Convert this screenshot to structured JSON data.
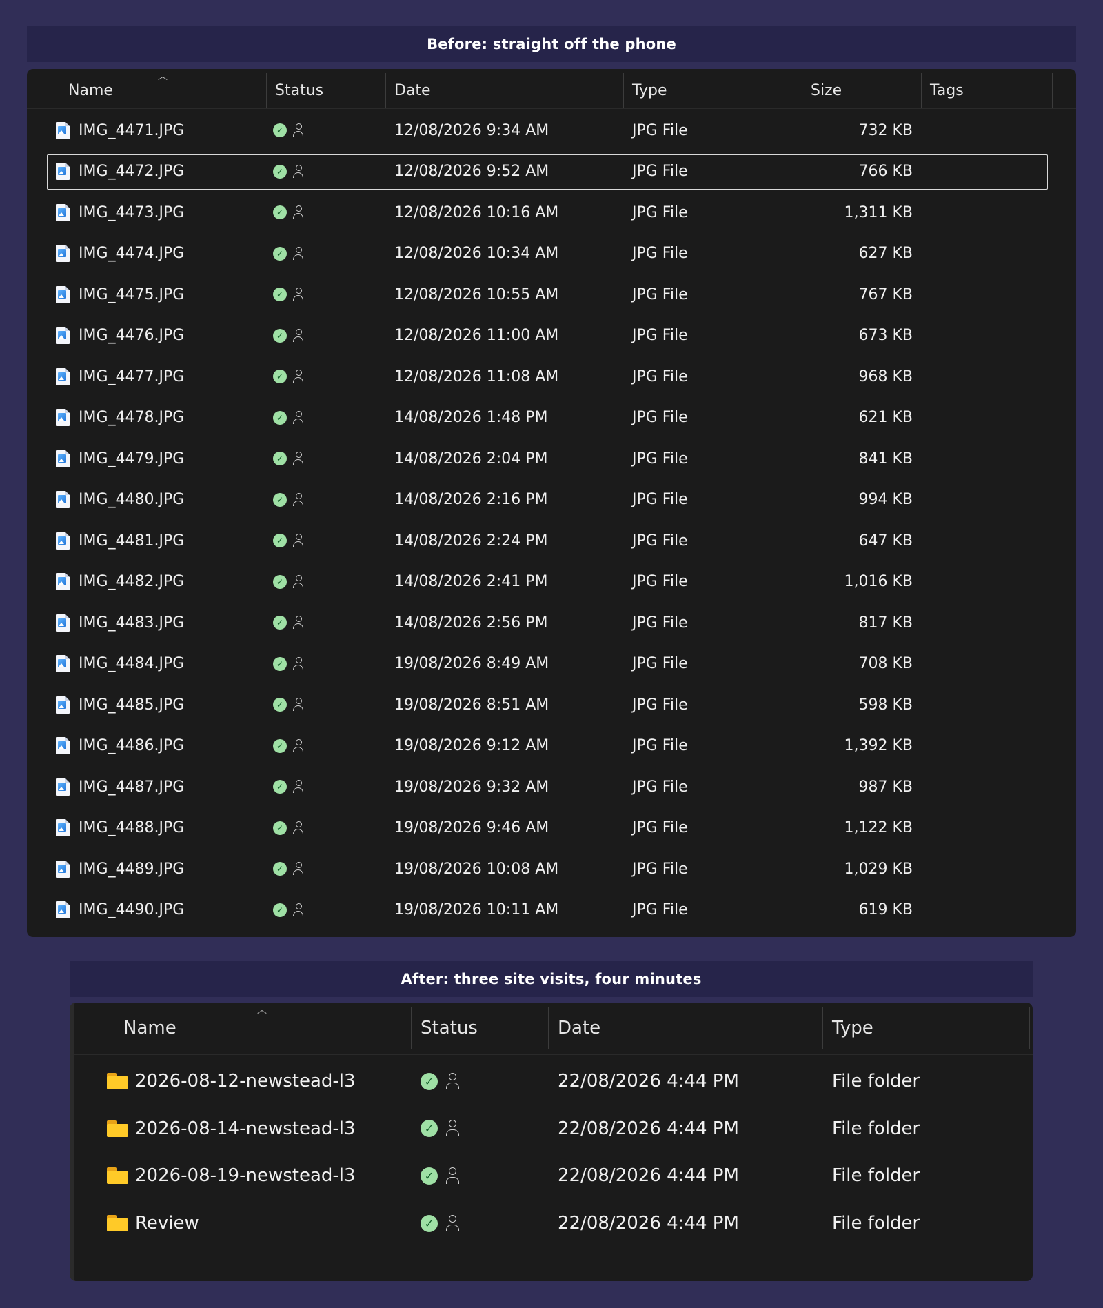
{
  "before": {
    "banner": "Before: straight off the phone",
    "columns": {
      "name": "Name",
      "status": "Status",
      "date": "Date",
      "type": "Type",
      "size": "Size",
      "tags": "Tags"
    },
    "selected_index": 1,
    "rows": [
      {
        "name": "IMG_4471.JPG",
        "date": "12/08/2026 9:34 AM",
        "type": "JPG File",
        "size": "732 KB"
      },
      {
        "name": "IMG_4472.JPG",
        "date": "12/08/2026 9:52 AM",
        "type": "JPG File",
        "size": "766 KB"
      },
      {
        "name": "IMG_4473.JPG",
        "date": "12/08/2026 10:16 AM",
        "type": "JPG File",
        "size": "1,311 KB"
      },
      {
        "name": "IMG_4474.JPG",
        "date": "12/08/2026 10:34 AM",
        "type": "JPG File",
        "size": "627 KB"
      },
      {
        "name": "IMG_4475.JPG",
        "date": "12/08/2026 10:55 AM",
        "type": "JPG File",
        "size": "767 KB"
      },
      {
        "name": "IMG_4476.JPG",
        "date": "12/08/2026 11:00 AM",
        "type": "JPG File",
        "size": "673 KB"
      },
      {
        "name": "IMG_4477.JPG",
        "date": "12/08/2026 11:08 AM",
        "type": "JPG File",
        "size": "968 KB"
      },
      {
        "name": "IMG_4478.JPG",
        "date": "14/08/2026 1:48 PM",
        "type": "JPG File",
        "size": "621 KB"
      },
      {
        "name": "IMG_4479.JPG",
        "date": "14/08/2026 2:04 PM",
        "type": "JPG File",
        "size": "841 KB"
      },
      {
        "name": "IMG_4480.JPG",
        "date": "14/08/2026 2:16 PM",
        "type": "JPG File",
        "size": "994 KB"
      },
      {
        "name": "IMG_4481.JPG",
        "date": "14/08/2026 2:24 PM",
        "type": "JPG File",
        "size": "647 KB"
      },
      {
        "name": "IMG_4482.JPG",
        "date": "14/08/2026 2:41 PM",
        "type": "JPG File",
        "size": "1,016 KB"
      },
      {
        "name": "IMG_4483.JPG",
        "date": "14/08/2026 2:56 PM",
        "type": "JPG File",
        "size": "817 KB"
      },
      {
        "name": "IMG_4484.JPG",
        "date": "19/08/2026 8:49 AM",
        "type": "JPG File",
        "size": "708 KB"
      },
      {
        "name": "IMG_4485.JPG",
        "date": "19/08/2026 8:51 AM",
        "type": "JPG File",
        "size": "598 KB"
      },
      {
        "name": "IMG_4486.JPG",
        "date": "19/08/2026 9:12 AM",
        "type": "JPG File",
        "size": "1,392 KB"
      },
      {
        "name": "IMG_4487.JPG",
        "date": "19/08/2026 9:32 AM",
        "type": "JPG File",
        "size": "987 KB"
      },
      {
        "name": "IMG_4488.JPG",
        "date": "19/08/2026 9:46 AM",
        "type": "JPG File",
        "size": "1,122 KB"
      },
      {
        "name": "IMG_4489.JPG",
        "date": "19/08/2026 10:08 AM",
        "type": "JPG File",
        "size": "1,029 KB"
      },
      {
        "name": "IMG_4490.JPG",
        "date": "19/08/2026 10:11 AM",
        "type": "JPG File",
        "size": "619 KB"
      }
    ]
  },
  "after": {
    "banner": "After: three site visits, four minutes",
    "columns": {
      "name": "Name",
      "status": "Status",
      "date": "Date",
      "type": "Type"
    },
    "rows": [
      {
        "name": "2026-08-12-newstead-l3",
        "date": "22/08/2026 4:44 PM",
        "type": "File folder"
      },
      {
        "name": "2026-08-14-newstead-l3",
        "date": "22/08/2026 4:44 PM",
        "type": "File folder"
      },
      {
        "name": "2026-08-19-newstead-l3",
        "date": "22/08/2026 4:44 PM",
        "type": "File folder"
      },
      {
        "name": "Review",
        "date": "22/08/2026 4:44 PM",
        "type": "File folder"
      }
    ]
  },
  "icons": {
    "file": "jpg-file-icon",
    "folder": "folder-icon",
    "status_synced": "synced-check-icon",
    "status_shared": "person-icon",
    "sort": "sort-ascending-caret-icon"
  },
  "colors": {
    "page_background": "#312e57",
    "banner_background": "#26244a",
    "panel_background": "#1b1b1b",
    "check_green": "#9fe0a5",
    "folder_yellow": "#ffca28"
  }
}
